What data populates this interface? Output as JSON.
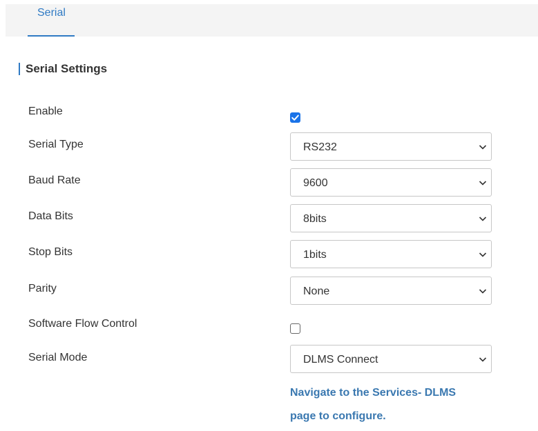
{
  "tabs": [
    {
      "label": "Serial",
      "active": true
    }
  ],
  "section": {
    "title": "Serial Settings"
  },
  "fields": {
    "enable": {
      "label": "Enable",
      "checked": true
    },
    "serial_type": {
      "label": "Serial Type",
      "value": "RS232"
    },
    "baud_rate": {
      "label": "Baud Rate",
      "value": "9600"
    },
    "data_bits": {
      "label": "Data Bits",
      "value": "8bits"
    },
    "stop_bits": {
      "label": "Stop Bits",
      "value": "1bits"
    },
    "parity": {
      "label": "Parity",
      "value": "None"
    },
    "software_flow_control": {
      "label": "Software Flow Control",
      "checked": false
    },
    "serial_mode": {
      "label": "Serial Mode",
      "value": "DLMS Connect"
    }
  },
  "hint": {
    "line1": "Navigate to the Services- DLMS",
    "line2": "page to configure."
  },
  "icons": {
    "dropdown": "chevron-down-icon",
    "checked": "checkmark-icon"
  },
  "colors": {
    "accent": "#2f7ac4",
    "checkbox_checked": "#1a73e8",
    "hint_link": "#3a78b0",
    "text": "#333333",
    "tabbar_bg": "#f4f4f4",
    "select_border": "#c6c6c6"
  }
}
